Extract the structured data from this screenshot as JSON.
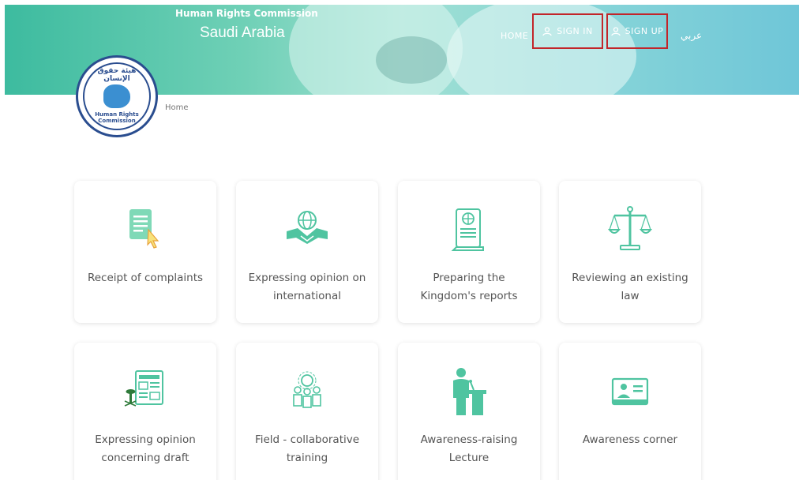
{
  "header": {
    "brand_top": "Human Rights Commission",
    "brand_main": "Saudi Arabia",
    "nav": {
      "home": "HOME",
      "sign_in": "SIGN IN",
      "sign_up": "SIGN UP",
      "language": "عربي"
    }
  },
  "logo": {
    "arabic_text": "هيئة حقوق الإنسان",
    "english_text": "Human Rights Commission"
  },
  "breadcrumb": {
    "home": "Home"
  },
  "services": [
    {
      "label": "Receipt of complaints",
      "icon": "document-cursor-icon"
    },
    {
      "label": "Expressing opinion on international",
      "icon": "handshake-globe-icon"
    },
    {
      "label": "Preparing the Kingdom's reports",
      "icon": "scroll-globe-icon"
    },
    {
      "label": "Reviewing an existing law",
      "icon": "scales-icon"
    },
    {
      "label": "Expressing opinion concerning draft",
      "icon": "newspaper-emblem-icon"
    },
    {
      "label": "Field - collaborative training",
      "icon": "team-training-icon"
    },
    {
      "label": "Awareness-raising Lecture",
      "icon": "lecturer-podium-icon"
    },
    {
      "label": "Awareness corner",
      "icon": "id-board-icon"
    }
  ],
  "colors": {
    "accent": "#4fc4a0",
    "highlight_border": "#c2252a",
    "logo_blue": "#2a4d8f"
  }
}
